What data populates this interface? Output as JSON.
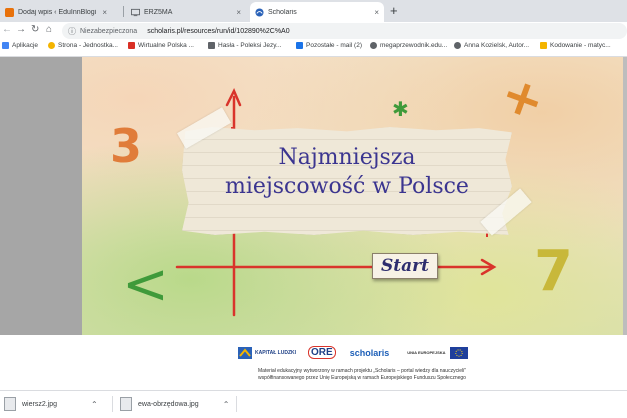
{
  "tabs": [
    {
      "label": "Dodaj wpis ‹ EduInnBlogi",
      "active": false
    },
    {
      "label": "ERZ5MA",
      "active": false
    },
    {
      "label": "Scholaris",
      "active": true
    }
  ],
  "new_tab_glyph": "+",
  "close_glyph": "×",
  "nav": {
    "back": "←",
    "forward": "→",
    "reload": "↻",
    "home": "⌂"
  },
  "address": {
    "security_label": "Niezabezpieczona",
    "url": "scholaris.pl/resources/run/id/102890%2C%A0"
  },
  "bookmarks": [
    {
      "label": "Aplikacje",
      "icon_color": "#4285f4"
    },
    {
      "label": "Strona - Jednostka...",
      "icon_color": "#f4b400"
    },
    {
      "label": "Wirtualne Polska ...",
      "icon_color": "#d93025"
    },
    {
      "label": "Hasła - Poleksi Jezy...",
      "icon_color": "#5f6368"
    },
    {
      "label": "Pozostałe - mail (2)",
      "icon_color": "#1a73e8"
    },
    {
      "label": "megaprzewodnik.edu...",
      "icon_color": "#5f6368"
    },
    {
      "label": "Anna Kozielsk, Autor...",
      "icon_color": "#5f6368"
    },
    {
      "label": "Kodowanie - matyc...",
      "icon_color": "#f4b400"
    }
  ],
  "app": {
    "title_line1": "Najmniejsza",
    "title_line2": "miejscowość w Polsce",
    "start_label": "Start",
    "deco": {
      "three": "3",
      "seven": "7",
      "plus": "+",
      "asterisk": "✱",
      "less_than": "<"
    }
  },
  "footer": {
    "logos": [
      "KAPITAŁ LUDZKI",
      "ORE",
      "scholaris",
      "UNIA EUROPEJSKA"
    ],
    "note_line1": "Materiał edukacyjny wytworzony w ramach projektu „Scholaris – portal wiedzy dla nauczycieli\"",
    "note_line2": "współfinansowanego przez Unię Europejską w ramach Europejskiego Funduszu Społecznego"
  },
  "downloads": [
    {
      "name": "wiersz2.jpg"
    },
    {
      "name": "ewa-obrzędowa.jpg"
    }
  ],
  "download_chevron": "⌃",
  "colors": {
    "title": "#3b3590",
    "arrow": "#d9342b",
    "green": "#3f9a3a",
    "yellow": "#d6c23a",
    "orange": "#e07c3a"
  }
}
